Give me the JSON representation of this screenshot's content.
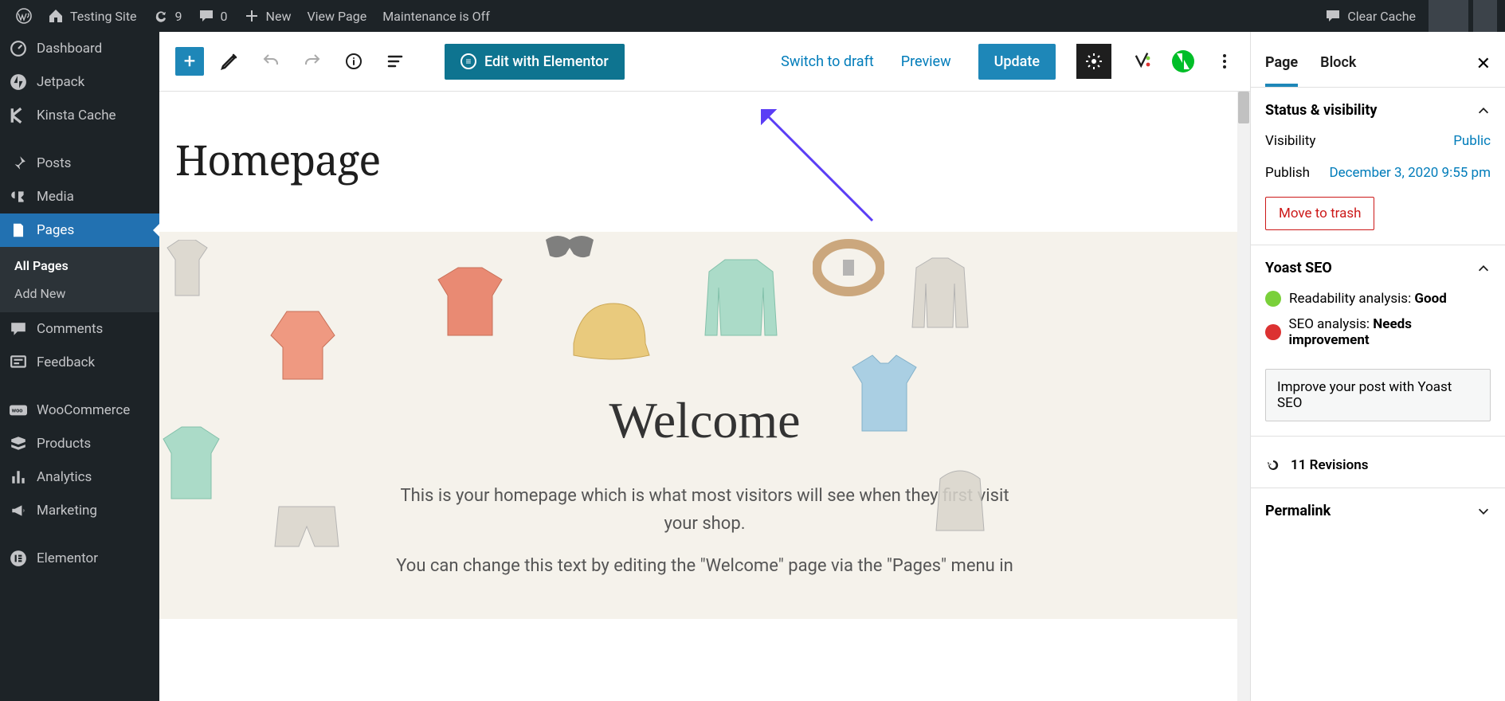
{
  "adminbar": {
    "site_name": "Testing Site",
    "refresh_count": "9",
    "comments_count": "0",
    "new_label": "New",
    "view_page": "View Page",
    "maintenance": "Maintenance is Off",
    "clear_cache": "Clear Cache"
  },
  "sidebar": {
    "items": [
      {
        "label": "Dashboard"
      },
      {
        "label": "Jetpack"
      },
      {
        "label": "Kinsta Cache"
      },
      {
        "label": "Posts"
      },
      {
        "label": "Media"
      },
      {
        "label": "Pages"
      },
      {
        "label": "Comments"
      },
      {
        "label": "Feedback"
      },
      {
        "label": "WooCommerce"
      },
      {
        "label": "Products"
      },
      {
        "label": "Analytics"
      },
      {
        "label": "Marketing"
      },
      {
        "label": "Elementor"
      }
    ],
    "submenu": [
      {
        "label": "All Pages",
        "selected": true
      },
      {
        "label": "Add New"
      }
    ]
  },
  "toolbar": {
    "elementor_label": "Edit with Elementor",
    "switch_draft": "Switch to draft",
    "preview": "Preview",
    "update": "Update"
  },
  "page": {
    "title": "Homepage",
    "hero_title": "Welcome",
    "hero_p1": "This is your homepage which is what most visitors will see when they first visit your shop.",
    "hero_p2": "You can change this text by editing the \"Welcome\" page via the \"Pages\" menu in"
  },
  "panel": {
    "tabs": {
      "page": "Page",
      "block": "Block"
    },
    "status": {
      "title": "Status & visibility",
      "visibility_label": "Visibility",
      "visibility_value": "Public",
      "publish_label": "Publish",
      "publish_value": "December 3, 2020 9:55 pm",
      "trash": "Move to trash"
    },
    "yoast": {
      "title": "Yoast SEO",
      "readability_label": "Readability analysis:",
      "readability_value": "Good",
      "seo_label": "SEO analysis:",
      "seo_value": "Needs improvement",
      "improve_btn": "Improve your post with Yoast SEO"
    },
    "revisions": {
      "label": "11 Revisions"
    },
    "permalink": {
      "title": "Permalink"
    }
  }
}
